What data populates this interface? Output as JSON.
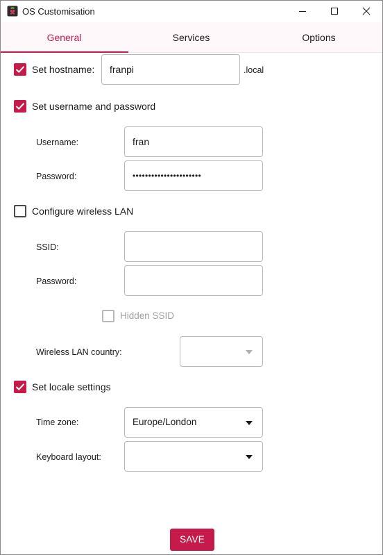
{
  "window": {
    "title": "OS Customisation"
  },
  "tabs": [
    {
      "label": "General",
      "selected": true
    },
    {
      "label": "Services",
      "selected": false
    },
    {
      "label": "Options",
      "selected": false
    }
  ],
  "hostname": {
    "checked": true,
    "label": "Set hostname:",
    "value": "franpi",
    "suffix": ".local"
  },
  "user": {
    "checked": true,
    "label": "Set username and password",
    "username_label": "Username:",
    "username_value": "fran",
    "password_label": "Password:",
    "password_value": "••••••••••••••••••••••"
  },
  "wifi": {
    "checked": false,
    "label": "Configure wireless LAN",
    "ssid_label": "SSID:",
    "ssid_value": "",
    "password_label": "Password:",
    "password_value": "",
    "hidden_ssid_label": "Hidden SSID",
    "hidden_ssid_checked": false,
    "country_label": "Wireless LAN country:",
    "country_value": ""
  },
  "locale": {
    "checked": true,
    "label": "Set locale settings",
    "timezone_label": "Time zone:",
    "timezone_value": "Europe/London",
    "keyboard_label": "Keyboard layout:",
    "keyboard_value": ""
  },
  "actions": {
    "save_label": "SAVE"
  },
  "colors": {
    "accent": "#c51a4a",
    "tab_background": "#fff8fb"
  },
  "icons": {
    "app": "raspberry-pi-icon",
    "minimize": "minimize-icon",
    "maximize": "maximize-icon",
    "close": "close-icon",
    "check": "checkmark-icon",
    "dropdown": "triangle-down-icon"
  }
}
